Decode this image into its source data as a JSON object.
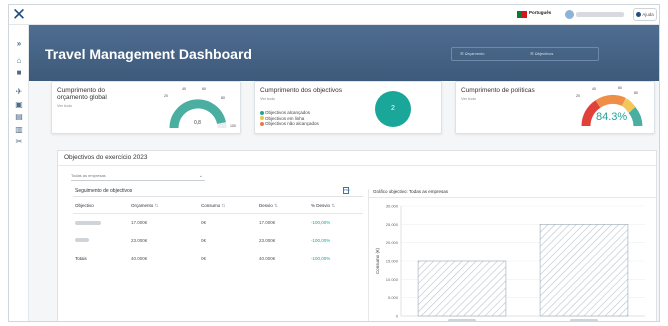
{
  "app": {
    "title": "Travel Management Dashboard"
  },
  "topbar": {
    "language": "Português",
    "help_label": "Ajuda",
    "brand_icon": "x-logo-icon"
  },
  "sidebar": {
    "icons": [
      "chevron-double-right-icon",
      "home-icon",
      "briefcase-icon",
      "plane-icon",
      "lock-icon",
      "document-icon",
      "chart-icon",
      "tools-icon"
    ]
  },
  "filters": {
    "left": "Orçamento",
    "right": "Objectivos"
  },
  "cards": [
    {
      "title": "Cumprimento do orçamento global",
      "sub": "Ver tudo",
      "gauge_ticks": [
        "0",
        "20",
        "40",
        "60",
        "80",
        "100"
      ],
      "value_label": "0,8"
    },
    {
      "title": "Cumprimento dos objectivos",
      "sub": "Ver tudo",
      "count": "2",
      "legend": [
        {
          "label": "Objectivos alcançados",
          "color": "#1aa79a"
        },
        {
          "label": "Objectivos em linha",
          "color": "#f0c24a"
        },
        {
          "label": "Objectivos não alcançados",
          "color": "#e57b46"
        }
      ]
    },
    {
      "title": "Cumprimento de políticas",
      "sub": "Ver tudo",
      "value": "84.3%",
      "gauge_ticks": [
        "0",
        "20",
        "40",
        "60",
        "80",
        "100"
      ]
    }
  ],
  "section": {
    "title": "Objectivos do exercício 2023",
    "select_value": "Todas as empresas",
    "table_title": "Seguimento de objectivos",
    "columns": [
      "Objectivo",
      "Orçamento",
      "Consumo",
      "Desvio",
      "% Desvio"
    ],
    "rows": [
      {
        "name": "",
        "budget": "17.000€",
        "consumo": "0€",
        "desvio": "17.000€",
        "pct": "-100,00%"
      },
      {
        "name": "",
        "budget": "23.000€",
        "consumo": "0€",
        "desvio": "23.000€",
        "pct": "-100,00%"
      },
      {
        "name": "Totais",
        "budget": "40.000€",
        "consumo": "0€",
        "desvio": "40.000€",
        "pct": "-100,00%"
      }
    ]
  },
  "chart_data": {
    "type": "bar",
    "title": "Gráfico objectivo: Todas as empresas",
    "ylabel": "Consumo (€)",
    "xlabel": "",
    "categories": [
      "",
      ""
    ],
    "values": [
      15000,
      25000
    ],
    "ylim": [
      0,
      30000
    ],
    "yticks": [
      "0",
      "5.000",
      "10.000",
      "15.000",
      "20.000",
      "25.000",
      "30.000"
    ],
    "bar_color": "#b9c3ce",
    "grid": true
  }
}
